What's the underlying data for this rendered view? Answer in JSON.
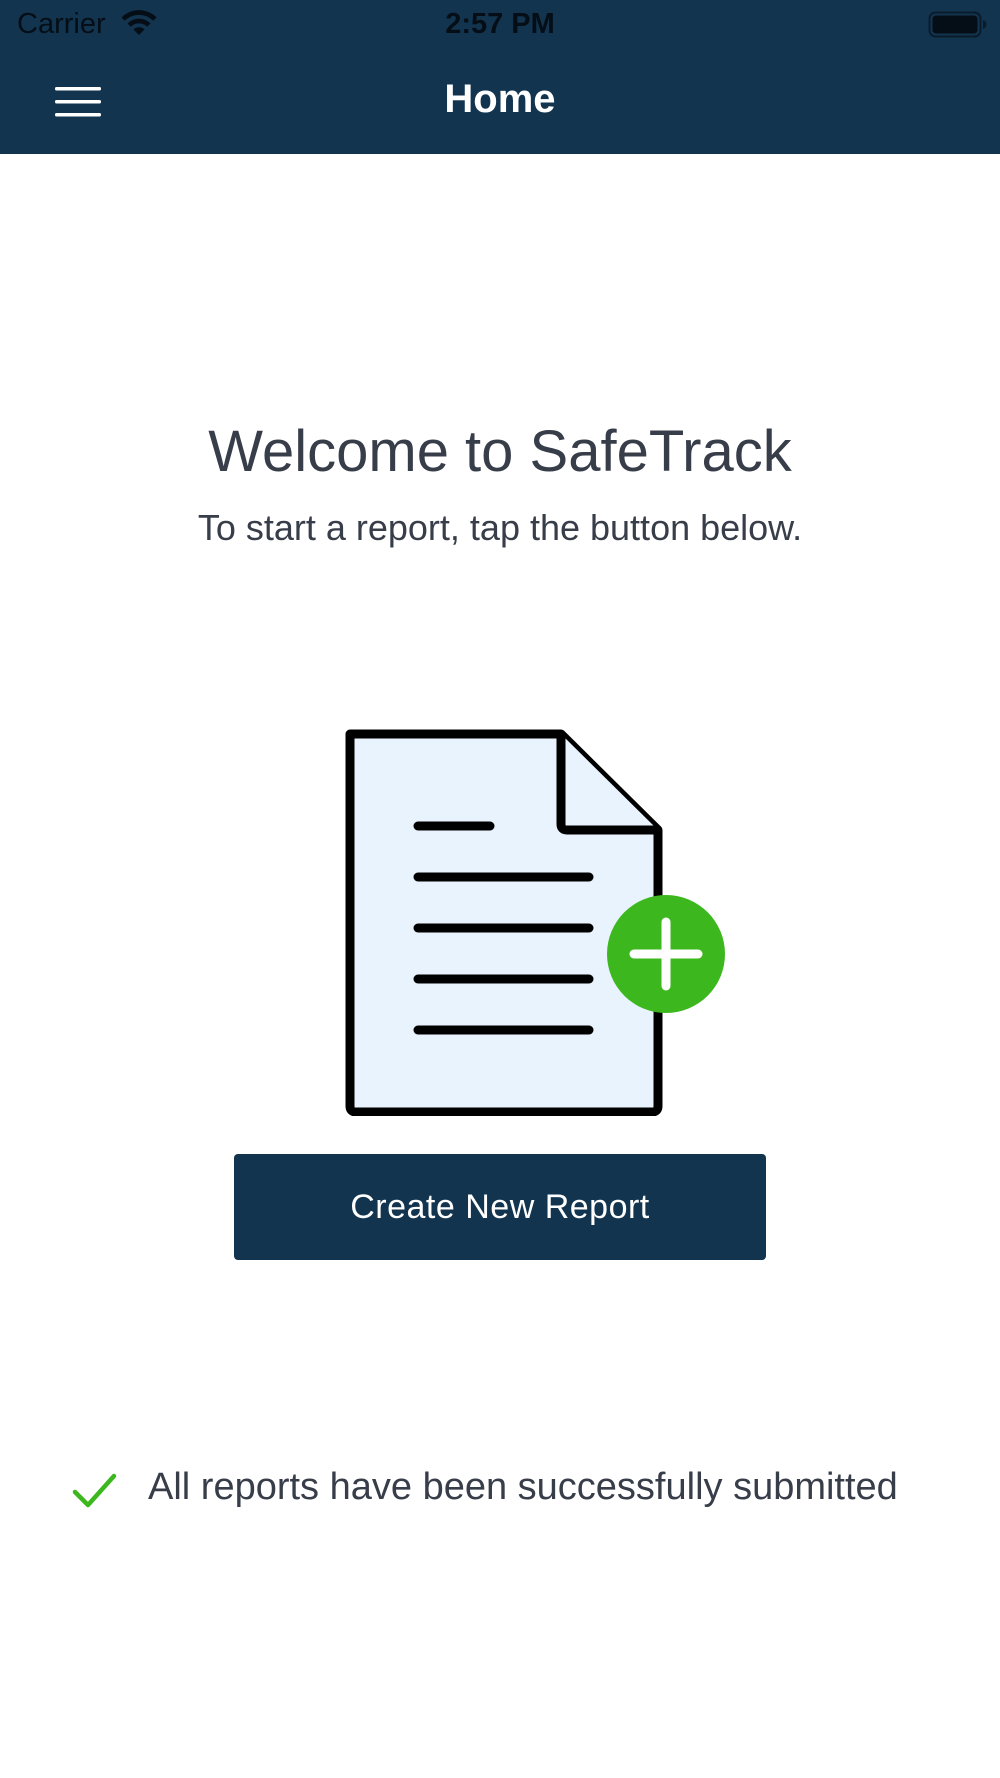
{
  "status_bar": {
    "carrier": "Carrier",
    "time": "2:57 PM",
    "wifi_icon": "wifi-icon",
    "battery_icon": "battery-full-icon"
  },
  "nav": {
    "title": "Home",
    "menu_icon": "hamburger-menu-icon"
  },
  "welcome": {
    "title": "Welcome to SafeTrack",
    "subtitle": "To start a report, tap the button below."
  },
  "illustration": {
    "icon": "new-document-icon",
    "badge_icon": "plus-icon"
  },
  "actions": {
    "create_label": "Create New Report"
  },
  "submission_status": {
    "icon": "checkmark-icon",
    "text": "All reports have been successfully submitted"
  },
  "colors": {
    "header_bg": "#12344f",
    "button_bg": "#12344f",
    "text": "#383d4a",
    "accent_green": "#3cb81e",
    "document_fill": "#e8f3fd"
  }
}
